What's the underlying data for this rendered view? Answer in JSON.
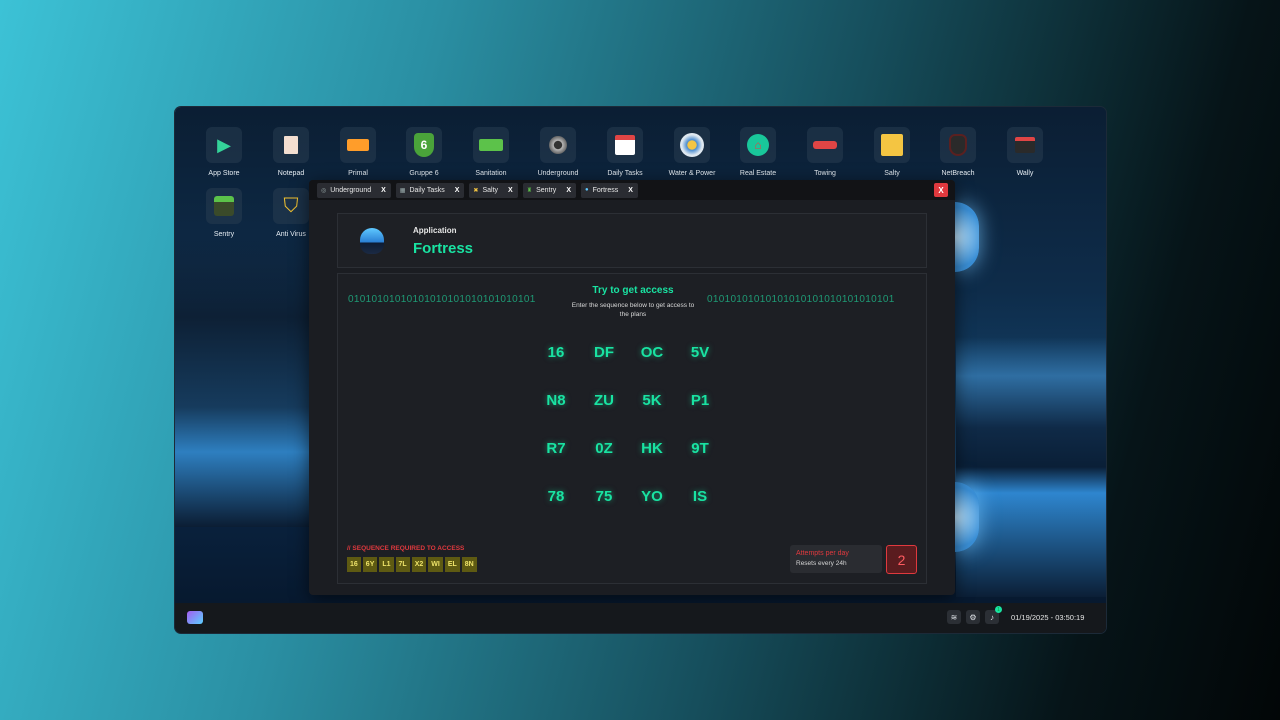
{
  "desktop": {
    "icons": [
      {
        "label": "App Store",
        "icon": "play-icon",
        "glyph": "▶",
        "color": "#34d399"
      },
      {
        "label": "Notepad",
        "icon": "notepad-icon",
        "glyph": "▯",
        "color": "#f3d9c9"
      },
      {
        "label": "Primal",
        "icon": "truck-icon",
        "glyph": "🚚",
        "color": "#ff9d2a"
      },
      {
        "label": "Gruppe 6",
        "icon": "shield-6-icon",
        "glyph": "6",
        "color": "#6dcb3e"
      },
      {
        "label": "Sanitation",
        "icon": "garbage-truck-icon",
        "glyph": "🚛",
        "color": "#5cc24a"
      },
      {
        "label": "Underground",
        "icon": "turbo-icon",
        "glyph": "◎",
        "color": "#b7b7b7"
      },
      {
        "label": "Daily Tasks",
        "icon": "calendar-icon",
        "glyph": "📅",
        "color": "#ffffff"
      },
      {
        "label": "Water & Power",
        "icon": "water-power-icon",
        "glyph": "◐",
        "color": "#7fb3e6"
      },
      {
        "label": "Real Estate",
        "icon": "house-icon",
        "glyph": "⌂",
        "color": "#19c79a"
      },
      {
        "label": "Towing",
        "icon": "tow-truck-icon",
        "glyph": "🚗",
        "color": "#e04545"
      },
      {
        "label": "Salty",
        "icon": "salty-icon",
        "glyph": "✖",
        "color": "#f4c542"
      },
      {
        "label": "NetBreach",
        "icon": "mask-icon",
        "glyph": "☗",
        "color": "#c94040"
      },
      {
        "label": "Wally",
        "icon": "wallet-icon",
        "glyph": "▣",
        "color": "#e04545"
      },
      {
        "label": "Sentry",
        "icon": "sentry-icon",
        "glyph": "♜",
        "color": "#5cc24a"
      },
      {
        "label": "Anti Virus",
        "icon": "antivirus-shield-icon",
        "glyph": "⛉",
        "color": "#f2c230"
      }
    ]
  },
  "window": {
    "tabs": [
      {
        "label": "Underground",
        "close": "X"
      },
      {
        "label": "Daily Tasks",
        "close": "X"
      },
      {
        "label": "Salty",
        "close": "X"
      },
      {
        "label": "Sentry",
        "close": "X"
      },
      {
        "label": "Fortress",
        "close": "X"
      }
    ],
    "close_label": "X"
  },
  "app": {
    "kicker": "Application",
    "name": "Fortress"
  },
  "panel": {
    "binary_left": "01010101010101010101010101010101",
    "binary_right": "01010101010101010101010101010101",
    "title": "Try to get access",
    "subtitle": "Enter the sequence below to get access to the plans",
    "grid": [
      [
        "16",
        "DF",
        "OC",
        "5V"
      ],
      [
        "N8",
        "ZU",
        "5K",
        "P1"
      ],
      [
        "R7",
        "0Z",
        "HK",
        "9T"
      ],
      [
        "78",
        "75",
        "YO",
        "IS"
      ]
    ],
    "sequence_label": "// SEQUENCE REQUIRED TO ACCESS",
    "sequence": [
      "16",
      "6Y",
      "L1",
      "7L",
      "X2",
      "WI",
      "EL",
      "8N"
    ],
    "attempts_title": "Attempts per day",
    "attempts_sub": "Resets every 24h",
    "attempts_count": "2"
  },
  "taskbar": {
    "notification_count": "1",
    "datetime": "01/19/2025 - 03:50:19"
  },
  "colors": {
    "accent": "#19e3a2",
    "danger": "#e0393e",
    "chip": "#5e5a12"
  }
}
